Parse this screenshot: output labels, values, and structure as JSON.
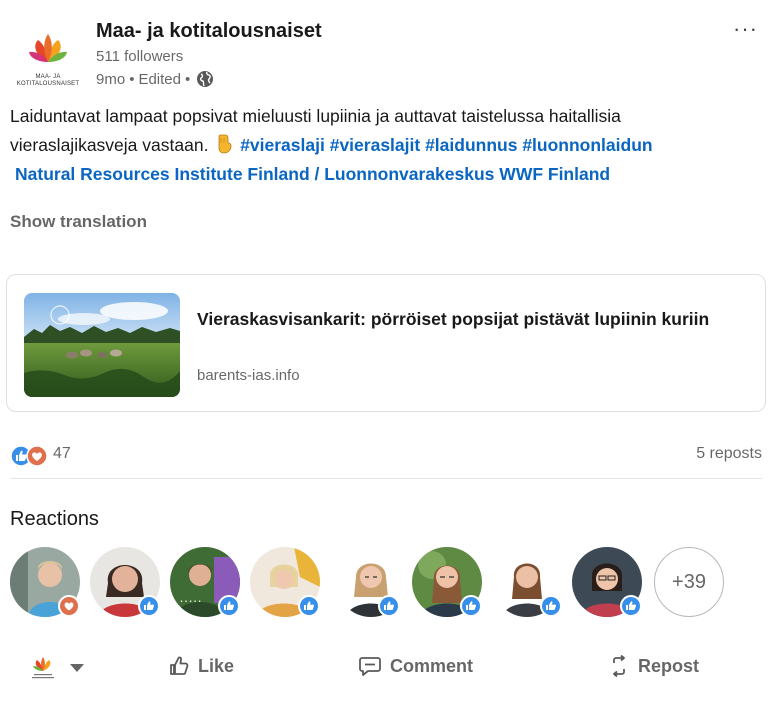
{
  "post": {
    "author": {
      "name": "Maa- ja kotitalousnaiset",
      "logo_text_line1": "MAA- JA",
      "logo_text_line2": "KOTITALOUSNAISET",
      "followers": "511 followers",
      "time": "9mo",
      "edited": "Edited",
      "separator": "•",
      "visibility_icon": "globe-icon"
    },
    "more_icon": "more-options-icon",
    "more_label": "···",
    "text": {
      "line1": "Laiduntavat lampaat popsivat mieluusti lupiinia ja auttavat taistelussa haitallisia",
      "line2": "vieraslajikasveja vastaan.",
      "emoji": "backhand-index-pointing-down-icon",
      "hashtags": [
        "#vieraslaji",
        "#vieraslajit",
        "#laidunnus",
        "#luonnonlaidun"
      ],
      "mentions": [
        "Natural Resources Institute Finland / Luonnonvarakeskus",
        "WWF Finland"
      ]
    },
    "show_translation": "Show translation",
    "link_card": {
      "title": "Vieraskasvisankarit: pörröiset popsijat pistävät lupiinin kuriin",
      "domain": "barents-ias.info"
    },
    "social": {
      "reaction_count": "47",
      "reaction_types": [
        "like-icon",
        "love-icon"
      ],
      "reposts": "5 reposts"
    },
    "reactions_heading": "Reactions",
    "reactors": [
      {
        "name": "reactor-1",
        "reaction": "love"
      },
      {
        "name": "reactor-2",
        "reaction": "like"
      },
      {
        "name": "reactor-3",
        "reaction": "like"
      },
      {
        "name": "reactor-4",
        "reaction": "like"
      },
      {
        "name": "reactor-5",
        "reaction": "like"
      },
      {
        "name": "reactor-6",
        "reaction": "like"
      },
      {
        "name": "reactor-7",
        "reaction": "like"
      },
      {
        "name": "reactor-8",
        "reaction": "like"
      }
    ],
    "more_reactors": "+39",
    "actions": {
      "like": "Like",
      "comment": "Comment",
      "repost": "Repost"
    }
  },
  "colors": {
    "link_blue": "#0a66c2",
    "like_blue": "#378fe9",
    "love_red": "#df704d"
  }
}
